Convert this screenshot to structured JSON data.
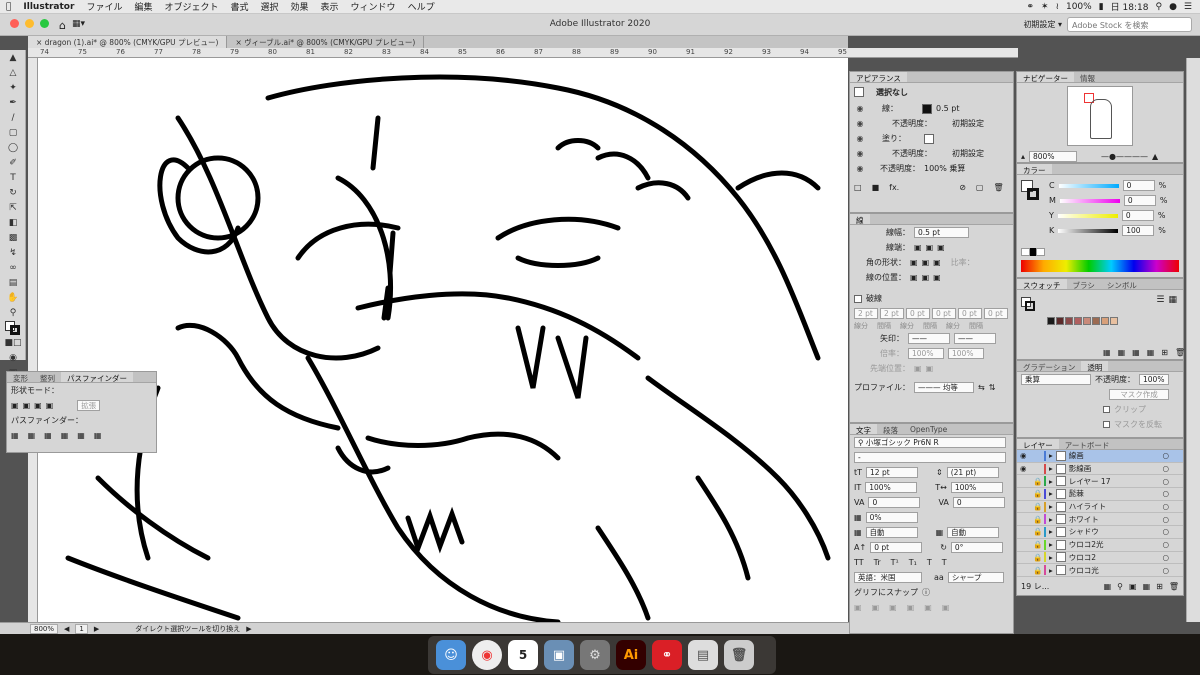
{
  "menubar": {
    "app": "Illustrator",
    "items": [
      "ファイル",
      "編集",
      "オブジェクト",
      "書式",
      "選択",
      "効果",
      "表示",
      "ウィンドウ",
      "ヘルプ"
    ],
    "battery": "100%",
    "clock": "日 18:18"
  },
  "appbar": {
    "title": "Adobe Illustrator 2020",
    "workspace": "初期設定",
    "stock_placeholder": "Adobe Stock を検索"
  },
  "tabs": [
    {
      "label": "dragon (1).ai* @ 800% (CMYK/GPU プレビュー)"
    },
    {
      "label": "ヴィーブル.ai* @ 800% (CMYK/GPU プレビュー)"
    }
  ],
  "ruler": {
    "ticks": [
      "74",
      "75",
      "76",
      "77",
      "78",
      "79",
      "80",
      "81",
      "82",
      "83",
      "84",
      "85",
      "86",
      "87",
      "88",
      "89",
      "90",
      "91",
      "92",
      "93",
      "94",
      "95"
    ]
  },
  "statusbar": {
    "zoom": "800%",
    "page": "1",
    "tool_hint": "ダイレクト選択ツールを切り換え"
  },
  "pathfinder": {
    "tabs": [
      "変形",
      "整列",
      "パスファインダー"
    ],
    "shape_mode_label": "形状モード：",
    "expand_label": "拡張",
    "pathfinder_label": "パスファインダー："
  },
  "appearance": {
    "tab": "アピアランス",
    "selection": "選択なし",
    "stroke_label": "線：",
    "stroke_value": "0.5 pt",
    "opacity_label": "不透明度：",
    "opacity_value": "初期設定",
    "fill_label": "塗り：",
    "fill_opacity_label": "不透明度：",
    "fill_opacity_value": "初期設定",
    "global_opacity_label": "不透明度：",
    "global_opacity_value": "100% 乗算",
    "fx": "fx."
  },
  "stroke": {
    "tab": "線",
    "weight_label": "線幅：",
    "weight_value": "0.5 pt",
    "cap_label": "線端：",
    "corner_label": "角の形状：",
    "limit_label": "比率：",
    "align_label": "線の位置：",
    "dashed_label": "破線",
    "dash_labels": [
      "線分",
      "間隔",
      "線分",
      "間隔",
      "線分",
      "間隔"
    ],
    "dash_values": [
      "2 pt",
      "2 pt",
      "0 pt",
      "0 pt",
      "0 pt",
      "0 pt"
    ],
    "arrow_label": "矢印：",
    "scale_label": "倍率：",
    "scale_values": [
      "100%",
      "100%"
    ],
    "tip_label": "先端位置：",
    "profile_label": "プロファイル：",
    "profile_value": "均等"
  },
  "character": {
    "tabs": [
      "文字",
      "段落",
      "OpenType"
    ],
    "font": "小塚ゴシック Pr6N R",
    "style": "-",
    "size": "12 pt",
    "leading": "(21 pt)",
    "hscale": "100%",
    "vscale": "100%",
    "kerning": "0",
    "tracking": "0",
    "tsume": "0%",
    "aki1": "自動",
    "aki2": "自動",
    "baseline": "0 pt",
    "rotation": "0°",
    "lang": "英語：米国",
    "aa": "シャープ",
    "snap": "グリフにスナップ"
  },
  "navigator": {
    "tabs": [
      "ナビゲーター",
      "情報"
    ],
    "zoom": "800%"
  },
  "color": {
    "tab": "カラー",
    "channels": [
      {
        "k": "C",
        "v": "0"
      },
      {
        "k": "M",
        "v": "0"
      },
      {
        "k": "Y",
        "v": "0"
      },
      {
        "k": "K",
        "v": "100"
      }
    ],
    "unit": "%"
  },
  "swatches": {
    "tabs": [
      "スウォッチ",
      "ブラシ",
      "シンボル"
    ],
    "colors": [
      "#1a1a1a",
      "#5b2a2a",
      "#8b4a4a",
      "#b06060",
      "#c98a7a",
      "#9c6b52",
      "#d8a07a",
      "#e8c0a0"
    ]
  },
  "transparency": {
    "tabs": [
      "グラデーション",
      "透明"
    ],
    "mode": "乗算",
    "opacity_label": "不透明度：",
    "opacity": "100%",
    "mask_button": "マスク作成",
    "clip": "クリップ",
    "invert": "マスクを反転"
  },
  "layers": {
    "tabs": [
      "レイヤー",
      "アートボード"
    ],
    "items": [
      {
        "name": "線画",
        "color": "#4a7bd6",
        "sel": true
      },
      {
        "name": "影線画",
        "color": "#d64a4a"
      },
      {
        "name": "レイヤー 17",
        "color": "#2aa84a"
      },
      {
        "name": "髭棘",
        "color": "#4a4ad6"
      },
      {
        "name": "ハイライト",
        "color": "#d6a02a"
      },
      {
        "name": "ホワイト",
        "color": "#c04ad6"
      },
      {
        "name": "シャドウ",
        "color": "#2a9ac8"
      },
      {
        "name": "ウロコ2光",
        "color": "#6ad62a"
      },
      {
        "name": "ウロコ2",
        "color": "#d6d62a"
      },
      {
        "name": "ウロコ光",
        "color": "#d64a9a"
      }
    ],
    "count": "19 レ..."
  }
}
